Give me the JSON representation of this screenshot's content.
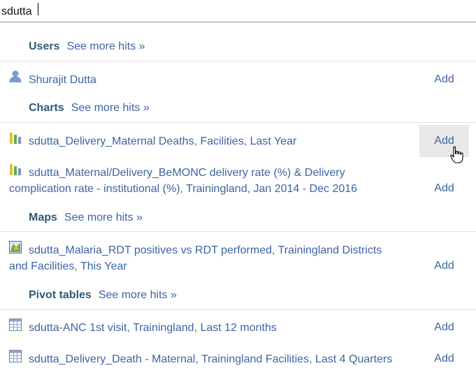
{
  "search": {
    "value": "sdutta"
  },
  "users": {
    "title": "Users",
    "see_more": "See more hits »",
    "items": [
      {
        "label": "Shurajit Dutta",
        "add": "Add"
      }
    ]
  },
  "charts": {
    "title": "Charts",
    "see_more": "See more hits »",
    "items": [
      {
        "label": "sdutta_Delivery_Maternal Deaths, Facilities, Last Year",
        "add": "Add"
      },
      {
        "label": "sdutta_Maternal/Delivery_BeMONC delivery rate (%) & Delivery complication rate - institutional (%), Trainingland, Jan 2014 - Dec 2016",
        "add": "Add"
      }
    ]
  },
  "maps": {
    "title": "Maps",
    "see_more": "See more hits »",
    "items": [
      {
        "label": "sdutta_Malaria_RDT positives vs RDT performed, Trainingland Districts and Facilities, This Year",
        "add": "Add"
      }
    ]
  },
  "pivot_tables": {
    "title": "Pivot tables",
    "see_more": "See more hits »",
    "items": [
      {
        "label": "sdutta-ANC 1st visit, Trainingland, Last 12 months",
        "add": "Add"
      },
      {
        "label": "sdutta_Delivery_Death - Maternal, Trainingland Facilities, Last 4 Quarters",
        "add": "Add"
      }
    ]
  },
  "colors": {
    "link": "#3f64a3",
    "section_title": "#2f5a78",
    "hover_bg": "#e8e8e8",
    "divider": "#e3e3e3"
  },
  "icons": {
    "user": "user-icon",
    "chart": "bar-chart-icon",
    "map": "map-icon",
    "pivot": "table-icon"
  }
}
